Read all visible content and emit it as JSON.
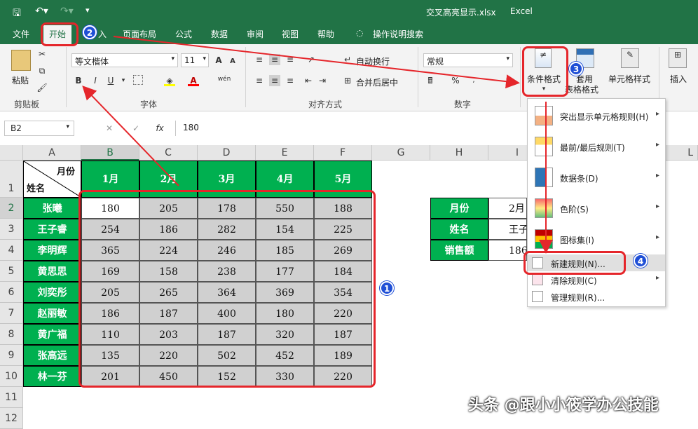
{
  "titlebar": {
    "title": "交叉高亮显示.xlsx",
    "app": "Excel"
  },
  "menu_tabs": [
    "文件",
    "开始",
    "入",
    "页面布局",
    "公式",
    "数据",
    "审阅",
    "视图",
    "帮助",
    "操作说明搜索"
  ],
  "ribbon": {
    "clipboard": {
      "paste": "粘贴",
      "group": "剪贴板"
    },
    "font": {
      "name": "等文楷体",
      "size": "11",
      "bold": "B",
      "italic": "I",
      "underline": "U",
      "grow": "A",
      "shrink": "A",
      "font_color": "A",
      "phonetic": "wén",
      "group": "字体"
    },
    "alignment": {
      "wrap": "自动换行",
      "merge": "合并后居中",
      "group": "对齐方式"
    },
    "number": {
      "format": "常规",
      "percent": "%",
      "group": "数字"
    },
    "styles": {
      "conditional": "条件格式",
      "table": "套用",
      "table2": "表格格式",
      "cell": "单元格样式"
    },
    "cells": {
      "insert": "插入"
    }
  },
  "formula_bar": {
    "namebox": "B2",
    "cancel": "✕",
    "enter": "✓",
    "fx": "fx",
    "value": "180"
  },
  "sheet": {
    "columns": [
      "A",
      "B",
      "C",
      "D",
      "E",
      "F",
      "G",
      "H",
      "I",
      "L"
    ],
    "rows": [
      "1",
      "2",
      "3",
      "4",
      "5",
      "6",
      "7",
      "8",
      "9",
      "10",
      "11",
      "12"
    ],
    "corner_top": "月份",
    "corner_bottom": "姓名",
    "months": [
      "1月",
      "2月",
      "3月",
      "4月",
      "5月"
    ],
    "names": [
      "张曦",
      "王子睿",
      "李明辉",
      "黄思思",
      "刘奕彤",
      "赵丽敏",
      "黄广福",
      "张高远",
      "林一芬"
    ],
    "values": [
      [
        180,
        205,
        178,
        550,
        188
      ],
      [
        254,
        186,
        282,
        154,
        225
      ],
      [
        365,
        224,
        246,
        185,
        269
      ],
      [
        169,
        158,
        238,
        177,
        184
      ],
      [
        205,
        265,
        364,
        369,
        354
      ],
      [
        186,
        187,
        400,
        180,
        220
      ],
      [
        110,
        203,
        187,
        320,
        187
      ],
      [
        135,
        220,
        502,
        452,
        189
      ],
      [
        201,
        450,
        152,
        330,
        220
      ]
    ],
    "lookup": {
      "labels": [
        "月份",
        "姓名",
        "销售额"
      ],
      "values": [
        "2月",
        "王子",
        "186"
      ]
    }
  },
  "dropdown": {
    "items": [
      "突出显示单元格规则(H)",
      "最前/最后规则(T)",
      "数据条(D)",
      "色阶(S)",
      "图标集(I)"
    ],
    "new_rule": "新建规则(N)...",
    "clear": "清除规则(C)",
    "manage": "管理规则(R)..."
  },
  "badges": [
    "1",
    "2",
    "3",
    "4"
  ],
  "watermark": "头条 @跟小小筱学办公技能",
  "colors": {
    "excel_green": "#217346",
    "cell_green": "#00b050",
    "annotation_red": "#e5262b",
    "badge_blue": "#1f4fd6"
  }
}
